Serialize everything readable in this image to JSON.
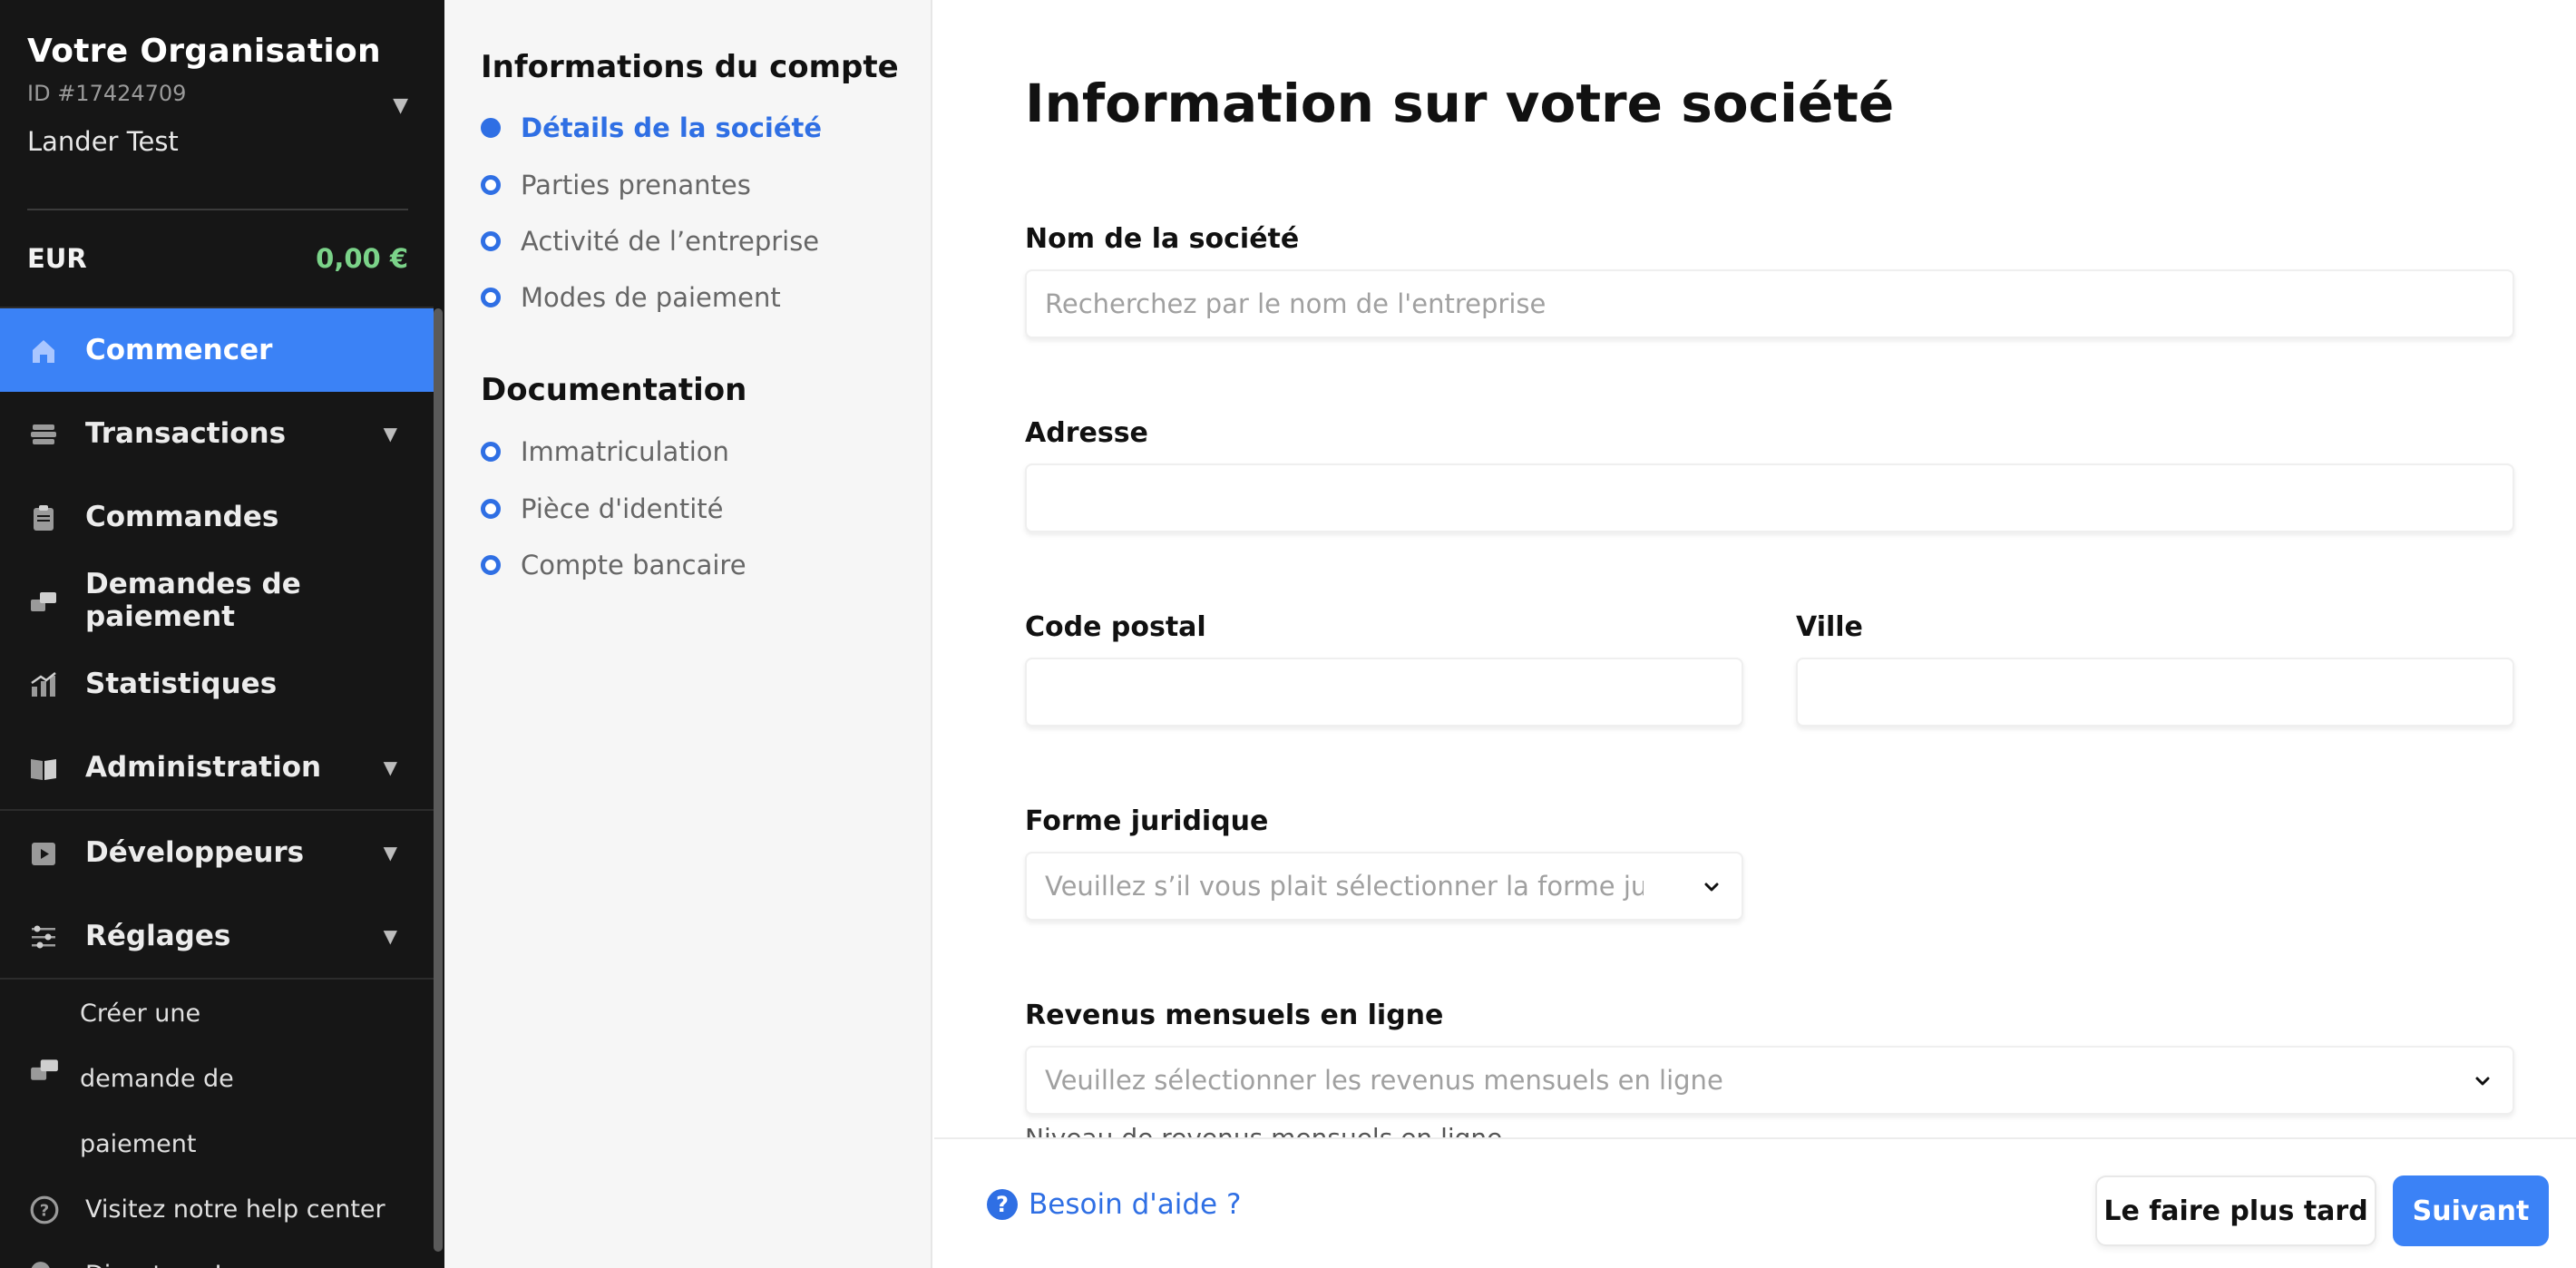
{
  "sidebar": {
    "org_name": "Votre Organisation",
    "org_id": "ID #17424709",
    "user_name": "Lander Test",
    "currency": "EUR",
    "balance": "0,00 €",
    "nav": [
      {
        "label": "Commencer",
        "icon": "home-icon",
        "active": true
      },
      {
        "label": "Transactions",
        "icon": "layers-icon"
      },
      {
        "label": "Commandes",
        "icon": "clipboard-icon"
      },
      {
        "label": "Demandes de paiement",
        "icon": "payment-request-icon"
      },
      {
        "label": "Statistiques",
        "icon": "chart-icon"
      },
      {
        "label": "Administration",
        "icon": "book-icon"
      },
      {
        "label": "Développeurs",
        "icon": "play-box-icon"
      },
      {
        "label": "Réglages",
        "icon": "sliders-icon"
      }
    ],
    "links": [
      {
        "label": "Créer une demande de paiement",
        "icon": "payment-request-icon"
      },
      {
        "label": "Visitez notre help center",
        "icon": "question-circle-icon"
      },
      {
        "label": "Discutons !",
        "icon": "chat-icon"
      }
    ]
  },
  "steps": {
    "section1_title": "Informations du compte",
    "section1_items": [
      "Détails de la société",
      "Parties prenantes",
      "Activité de l’entreprise",
      "Modes de paiement"
    ],
    "section2_title": "Documentation",
    "section2_items": [
      "Immatriculation",
      "Pièce d'identité",
      "Compte bancaire"
    ]
  },
  "form": {
    "title": "Information sur votre société",
    "company_name_label": "Nom de la société",
    "company_name_placeholder": "Recherchez par le nom de l'entreprise",
    "address_label": "Adresse",
    "address_value": "",
    "postal_code_label": "Code postal",
    "postal_code_value": "",
    "city_label": "Ville",
    "city_value": "",
    "legal_form_label": "Forme juridique",
    "legal_form_placeholder": "Veuillez s’il vous plait sélectionner la forme jurid",
    "revenue_label": "Revenus mensuels en ligne",
    "revenue_placeholder": "Veuillez sélectionner les revenus mensuels en ligne",
    "cut_off_text": "Niveau de revenus mensuels en ligne"
  },
  "footer": {
    "help_label": "Besoin d'aide ?",
    "later_label": "Le faire plus tard",
    "next_label": "Suivant"
  },
  "colors": {
    "accent": "#3b82f6",
    "sidebar_bg": "#161616",
    "balance_green": "#7bd389"
  }
}
